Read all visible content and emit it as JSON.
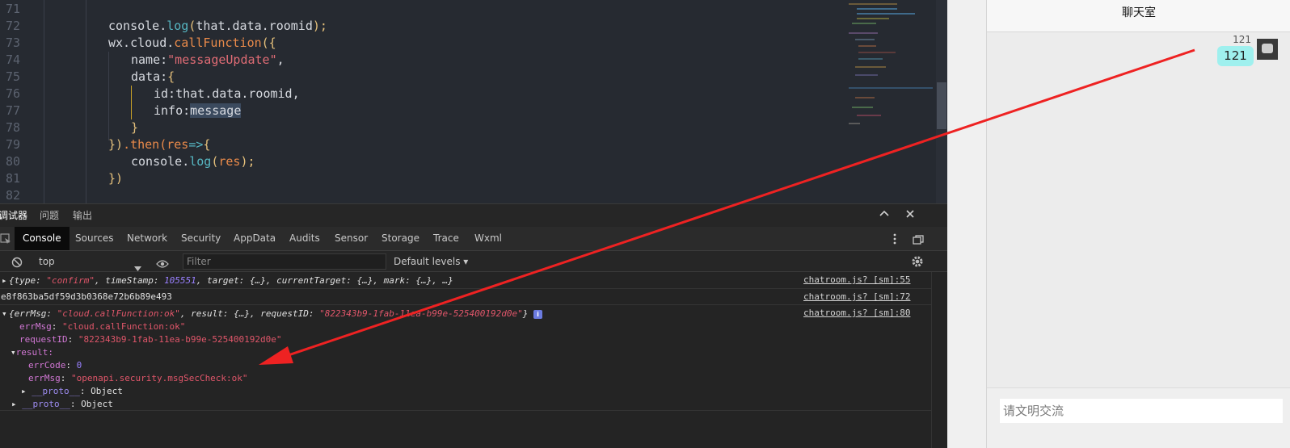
{
  "editor": {
    "line_numbers": [
      "71",
      "72",
      "73",
      "74",
      "75",
      "76",
      "77",
      "78",
      "79",
      "80",
      "81",
      "82"
    ],
    "code": {
      "l72": {
        "a": "console.",
        "b": "log",
        "c": "(",
        "d": "that.data.roomid",
        "e": ");"
      },
      "l73": {
        "a": "wx.cloud.",
        "b": "callFunction",
        "c": "({"
      },
      "l74": {
        "a": "name:",
        "b": "\"messageUpdate\"",
        "c": ","
      },
      "l75": {
        "a": "data:",
        "b": "{"
      },
      "l76": {
        "a": "id:that.data.roomid,"
      },
      "l77": {
        "a": "info:",
        "b": "message"
      },
      "l78": {
        "a": "}"
      },
      "l79": {
        "a": "})",
        "b": ".then(",
        "c": "res",
        "d": "=>",
        "e": "{"
      },
      "l80": {
        "a": "console.",
        "b": "log",
        "c": "(",
        "d": "res",
        "e": ");"
      },
      "l81": {
        "a": "})"
      }
    }
  },
  "devtools": {
    "panel_tabs": [
      "调试器",
      "问题",
      "输出"
    ],
    "tool_tabs": [
      "Console",
      "Sources",
      "Network",
      "Security",
      "AppData",
      "Audits",
      "Sensor",
      "Storage",
      "Trace",
      "Wxml"
    ],
    "context": "top",
    "filter_placeholder": "Filter",
    "levels": "Default levels",
    "messages": [
      {
        "text_parts": [
          "{type: ",
          "\"confirm\"",
          ", timeStamp: ",
          "105551",
          ", target: {…}, currentTarget: {…}, mark: {…}, …}"
        ],
        "source": "chatroom.js? [sm]:55"
      },
      {
        "text": "e8f863ba5df59d3b0368e72b6b89e493",
        "source": "chatroom.js? [sm]:72"
      },
      {
        "summary_parts": [
          "{errMsg: ",
          "\"cloud.callFunction:ok\"",
          ", result: {…}, requestID: ",
          "\"822343b9-1fab-11ea-b99e-525400192d0e\"",
          "}"
        ],
        "source": "chatroom.js? [sm]:80",
        "tree": {
          "errMsg_key": "errMsg",
          "errMsg_val": "\"cloud.callFunction:ok\"",
          "requestID_key": "requestID",
          "requestID_val": "\"822343b9-1fab-11ea-b99e-525400192d0e\"",
          "result_key": "result:",
          "errCode_key": "errCode",
          "errCode_val": "0",
          "inner_errMsg_key": "errMsg",
          "inner_errMsg_val": "\"openapi.security.msgSecCheck:ok\"",
          "proto_key": "__proto__",
          "proto_val": "Object"
        }
      }
    ]
  },
  "phone": {
    "title": "聊天室",
    "message": {
      "name": "121",
      "text": "121"
    },
    "input_placeholder": "请文明交流"
  },
  "colors": {
    "annotation_arrow": "#ee2222",
    "bubble": "#9ff0ee"
  },
  "icons": [
    "inspect-icon",
    "device-icon",
    "clear-console-icon",
    "eye-icon",
    "gear-icon",
    "more-icon",
    "dock-icon",
    "collapse-icon",
    "close-icon"
  ]
}
